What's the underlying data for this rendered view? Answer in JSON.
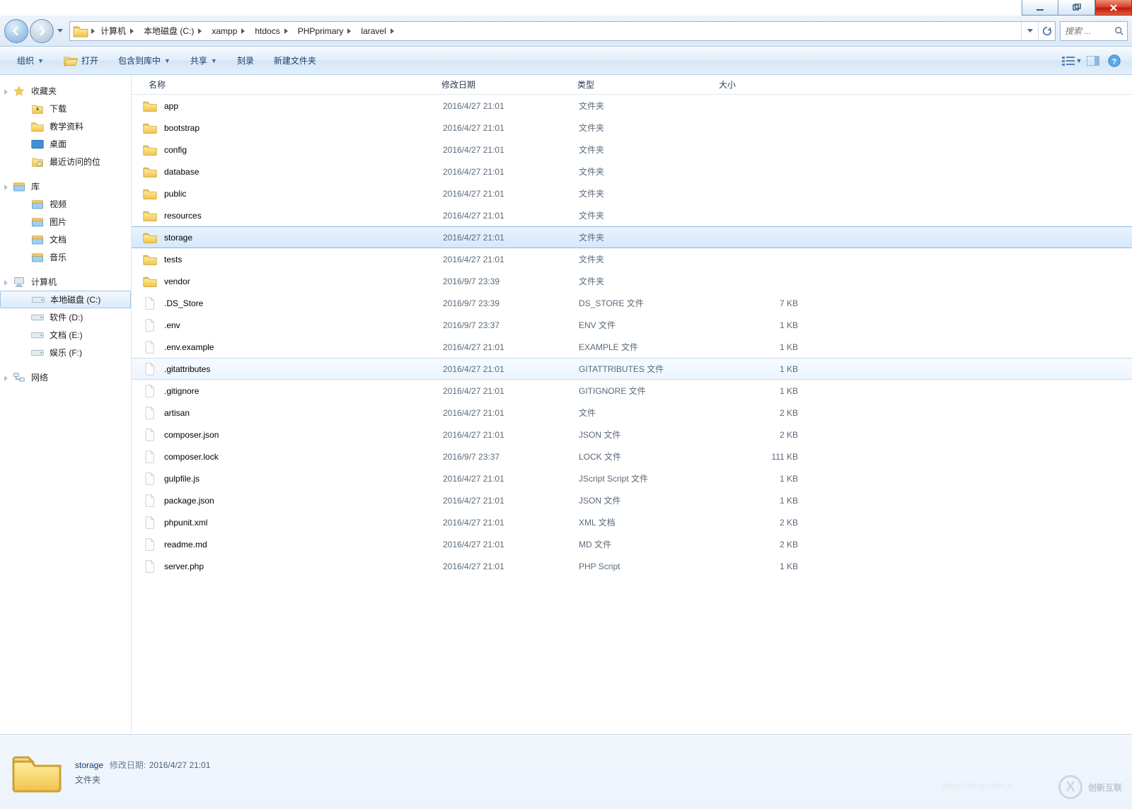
{
  "breadcrumbs": [
    "计算机",
    "本地磁盘 (C:)",
    "xampp",
    "htdocs",
    "PHPprimary",
    "laravel"
  ],
  "search_placeholder": "搜索 ...",
  "toolbar": {
    "organize": "组织",
    "open": "打开",
    "include": "包含到库中",
    "share": "共享",
    "burn": "刻录",
    "newfolder": "新建文件夹"
  },
  "sidebar": {
    "favorites": {
      "label": "收藏夹",
      "items": [
        "下载",
        "教学资料",
        "桌面",
        "最近访问的位"
      ]
    },
    "libraries": {
      "label": "库",
      "items": [
        "视频",
        "图片",
        "文档",
        "音乐"
      ]
    },
    "computer": {
      "label": "计算机",
      "items": [
        "本地磁盘 (C:)",
        "软件 (D:)",
        "文档 (E:)",
        "娱乐 (F:)"
      ]
    },
    "network": {
      "label": "网络"
    }
  },
  "columns": {
    "name": "名称",
    "date": "修改日期",
    "type": "类型",
    "size": "大小"
  },
  "files": [
    {
      "icon": "folder",
      "name": "app",
      "date": "2016/4/27 21:01",
      "type": "文件夹",
      "size": ""
    },
    {
      "icon": "folder",
      "name": "bootstrap",
      "date": "2016/4/27 21:01",
      "type": "文件夹",
      "size": ""
    },
    {
      "icon": "folder",
      "name": "config",
      "date": "2016/4/27 21:01",
      "type": "文件夹",
      "size": ""
    },
    {
      "icon": "folder",
      "name": "database",
      "date": "2016/4/27 21:01",
      "type": "文件夹",
      "size": ""
    },
    {
      "icon": "folder",
      "name": "public",
      "date": "2016/4/27 21:01",
      "type": "文件夹",
      "size": ""
    },
    {
      "icon": "folder",
      "name": "resources",
      "date": "2016/4/27 21:01",
      "type": "文件夹",
      "size": ""
    },
    {
      "icon": "folder",
      "name": "storage",
      "date": "2016/4/27 21:01",
      "type": "文件夹",
      "size": "",
      "state": "selected"
    },
    {
      "icon": "folder",
      "name": "tests",
      "date": "2016/4/27 21:01",
      "type": "文件夹",
      "size": ""
    },
    {
      "icon": "folder",
      "name": "vendor",
      "date": "2016/9/7 23:39",
      "type": "文件夹",
      "size": ""
    },
    {
      "icon": "file",
      "name": ".DS_Store",
      "date": "2016/9/7 23:39",
      "type": "DS_STORE 文件",
      "size": "7 KB"
    },
    {
      "icon": "file",
      "name": ".env",
      "date": "2016/9/7 23:37",
      "type": "ENV 文件",
      "size": "1 KB"
    },
    {
      "icon": "file",
      "name": ".env.example",
      "date": "2016/4/27 21:01",
      "type": "EXAMPLE 文件",
      "size": "1 KB"
    },
    {
      "icon": "file",
      "name": ".gitattributes",
      "date": "2016/4/27 21:01",
      "type": "GITATTRIBUTES 文件",
      "size": "1 KB",
      "state": "hover"
    },
    {
      "icon": "file",
      "name": ".gitignore",
      "date": "2016/4/27 21:01",
      "type": "GITIGNORE 文件",
      "size": "1 KB"
    },
    {
      "icon": "file",
      "name": "artisan",
      "date": "2016/4/27 21:01",
      "type": "文件",
      "size": "2 KB"
    },
    {
      "icon": "file",
      "name": "composer.json",
      "date": "2016/4/27 21:01",
      "type": "JSON 文件",
      "size": "2 KB"
    },
    {
      "icon": "file",
      "name": "composer.lock",
      "date": "2016/9/7 23:37",
      "type": "LOCK 文件",
      "size": "111 KB"
    },
    {
      "icon": "js",
      "name": "gulpfile.js",
      "date": "2016/4/27 21:01",
      "type": "JScript Script 文件",
      "size": "1 KB"
    },
    {
      "icon": "file",
      "name": "package.json",
      "date": "2016/4/27 21:01",
      "type": "JSON 文件",
      "size": "1 KB"
    },
    {
      "icon": "xml",
      "name": "phpunit.xml",
      "date": "2016/4/27 21:01",
      "type": "XML 文档",
      "size": "2 KB"
    },
    {
      "icon": "file",
      "name": "readme.md",
      "date": "2016/4/27 21:01",
      "type": "MD 文件",
      "size": "2 KB"
    },
    {
      "icon": "php",
      "name": "server.php",
      "date": "2016/4/27 21:01",
      "type": "PHP Script",
      "size": "1 KB"
    }
  ],
  "details": {
    "name": "storage",
    "date_label": "修改日期:",
    "date": "2016/4/27 21:01",
    "type": "文件夹"
  },
  "watermark": "创新互联",
  "watermark2": "https://blog.csdn.n"
}
